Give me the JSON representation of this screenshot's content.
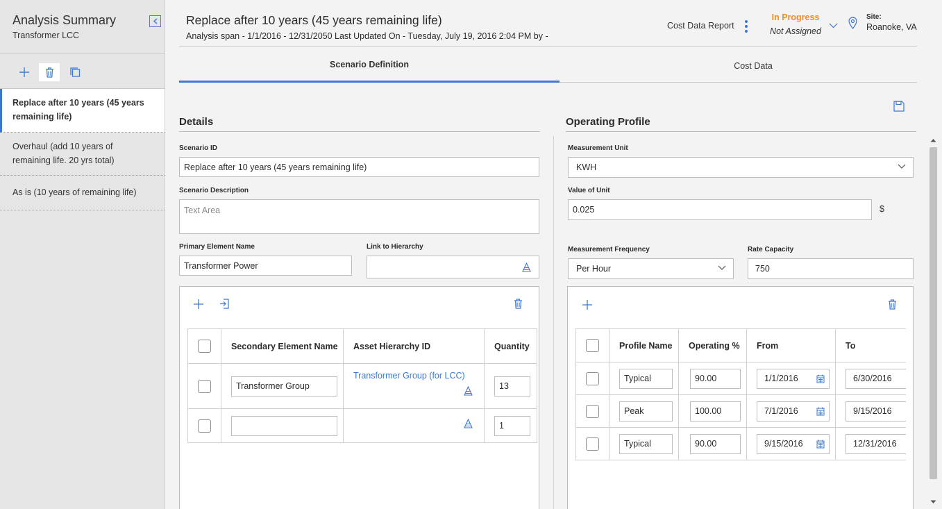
{
  "sidebar": {
    "title": "Analysis Summary",
    "subtitle": "Transformer LCC",
    "tool_icons": [
      "plus-icon",
      "trash-icon",
      "copy-icon"
    ],
    "scenarios": [
      {
        "label": "Replace after 10 years (45 years remaining life)",
        "selected": true
      },
      {
        "label": "Overhaul (add 10 years of remaining life. 20 yrs total)",
        "selected": false
      },
      {
        "label": "As is (10 years of remaining life)",
        "selected": false
      }
    ]
  },
  "header": {
    "title": "Replace after 10 years (45 years remaining life)",
    "span": "Analysis span - 1/1/2016 - 12/31/2050 Last Updated On - Tuesday, July 19, 2016 2:04 PM by -",
    "report_label": "Cost Data Report",
    "status": "In Progress",
    "assignee": "Not Assigned",
    "site_label": "Site:",
    "site_value": "Roanoke, VA"
  },
  "tabs": [
    {
      "label": "Scenario Definition",
      "active": true
    },
    {
      "label": "Cost Data",
      "active": false
    }
  ],
  "details": {
    "heading": "Details",
    "scenario_id_label": "Scenario ID",
    "scenario_id_value": "Replace after 10 years (45 years remaining life)",
    "description_label": "Scenario Description",
    "description_placeholder": "Text Area",
    "primary_label": "Primary Element Name",
    "primary_value": "Transformer Power",
    "link_label": "Link to Hierarchy",
    "link_value": "",
    "columns": [
      "Secondary Element Name",
      "Asset Hierarchy ID",
      "Quantity"
    ],
    "rows": [
      {
        "name": "Transformer Group",
        "hierarchy": "Transformer Group (for LCC)",
        "quantity": "13"
      },
      {
        "name": "",
        "hierarchy": "",
        "quantity": "1"
      }
    ]
  },
  "operating": {
    "heading": "Operating Profile",
    "unit_label": "Measurement Unit",
    "unit_value": "KWH",
    "value_label": "Value of Unit",
    "value_value": "0.025",
    "currency": "$",
    "freq_label": "Measurement Frequency",
    "freq_value": "Per Hour",
    "rate_label": "Rate Capacity",
    "rate_value": "750",
    "columns": [
      "Profile Name",
      "Operating %",
      "From",
      "To"
    ],
    "rows": [
      {
        "name": "Typical",
        "pct": "90.00",
        "from": "1/1/2016",
        "to": "6/30/2016"
      },
      {
        "name": "Peak",
        "pct": "100.00",
        "from": "7/1/2016",
        "to": "9/15/2016"
      },
      {
        "name": "Typical",
        "pct": "90.00",
        "from": "9/15/2016",
        "to": "12/31/2016"
      }
    ]
  },
  "colors": {
    "accent": "#3a78d6",
    "status": "#f0901e"
  }
}
